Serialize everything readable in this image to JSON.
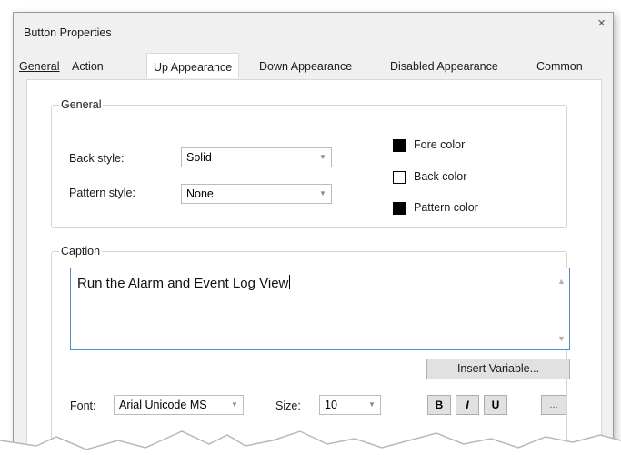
{
  "title": "Button Properties",
  "close_glyph": "×",
  "tabs": [
    "General",
    "Action",
    "Up Appearance",
    "Down Appearance",
    "Disabled Appearance",
    "Common"
  ],
  "active_tab": "Up Appearance",
  "general_group": {
    "legend": "General",
    "back_style": {
      "label": "Back style:",
      "value": "Solid"
    },
    "pattern_style": {
      "label": "Pattern style:",
      "value": "None"
    },
    "colors": [
      {
        "label": "Fore color",
        "swatch": "#000000"
      },
      {
        "label": "Back color",
        "swatch": "#ffffff"
      },
      {
        "label": "Pattern color",
        "swatch": "#000000"
      }
    ]
  },
  "caption_group": {
    "legend": "Caption",
    "text": "Run the Alarm and Event Log View",
    "insert_variable_label": "Insert Variable...",
    "font_label": "Font:",
    "font_value": "Arial Unicode MS",
    "size_label": "Size:",
    "size_value": "10",
    "bold_label": "B",
    "italic_label": "I",
    "underline_label": "U",
    "more_label": "..."
  },
  "colors": {
    "accent_border": "#4a90d9",
    "dialog_bg": "#f0f0f0"
  }
}
